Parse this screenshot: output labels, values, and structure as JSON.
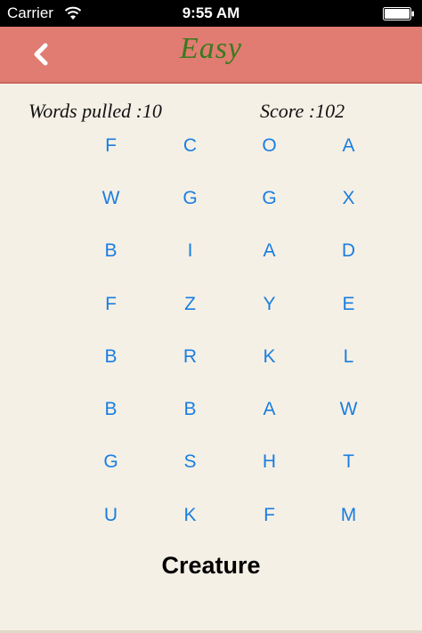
{
  "status_bar": {
    "carrier": "Carrier",
    "time": "9:55 AM"
  },
  "nav": {
    "title": "Easy"
  },
  "stats": {
    "words_pulled": "Words pulled :10",
    "score": "Score :102"
  },
  "grid": [
    [
      "F",
      "C",
      "O",
      "A"
    ],
    [
      "W",
      "G",
      "G",
      "X"
    ],
    [
      "B",
      "I",
      "A",
      "D"
    ],
    [
      "F",
      "Z",
      "Y",
      "E"
    ],
    [
      "B",
      "R",
      "K",
      "L"
    ],
    [
      "B",
      "B",
      "A",
      "W"
    ],
    [
      "G",
      "S",
      "H",
      "T"
    ],
    [
      "U",
      "K",
      "F",
      "M"
    ]
  ],
  "target_word": "Creature",
  "colors": {
    "nav_background": "#e07c72",
    "title_color": "#3a7a1e",
    "letter_color": "#1a7ee0",
    "page_background": "#f5f0e6"
  }
}
